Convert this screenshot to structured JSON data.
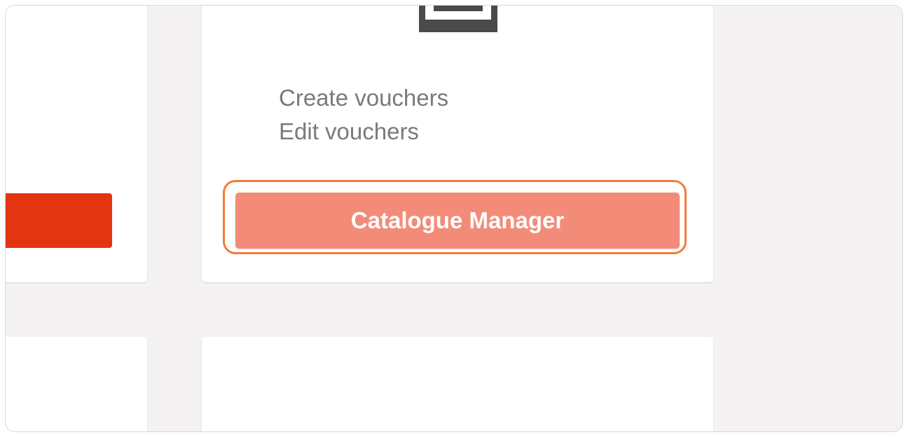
{
  "panel": {
    "feature_list": [
      "Create vouchers",
      "Edit vouchers"
    ],
    "primary_button_label": "Catalogue Manager"
  },
  "colors": {
    "left_button": "#e33512",
    "catalogue_button": "#f28c79",
    "focus_ring": "#f47a3c",
    "background": "#f4f2f3"
  },
  "icons": {
    "panel_icon": "document-icon"
  }
}
